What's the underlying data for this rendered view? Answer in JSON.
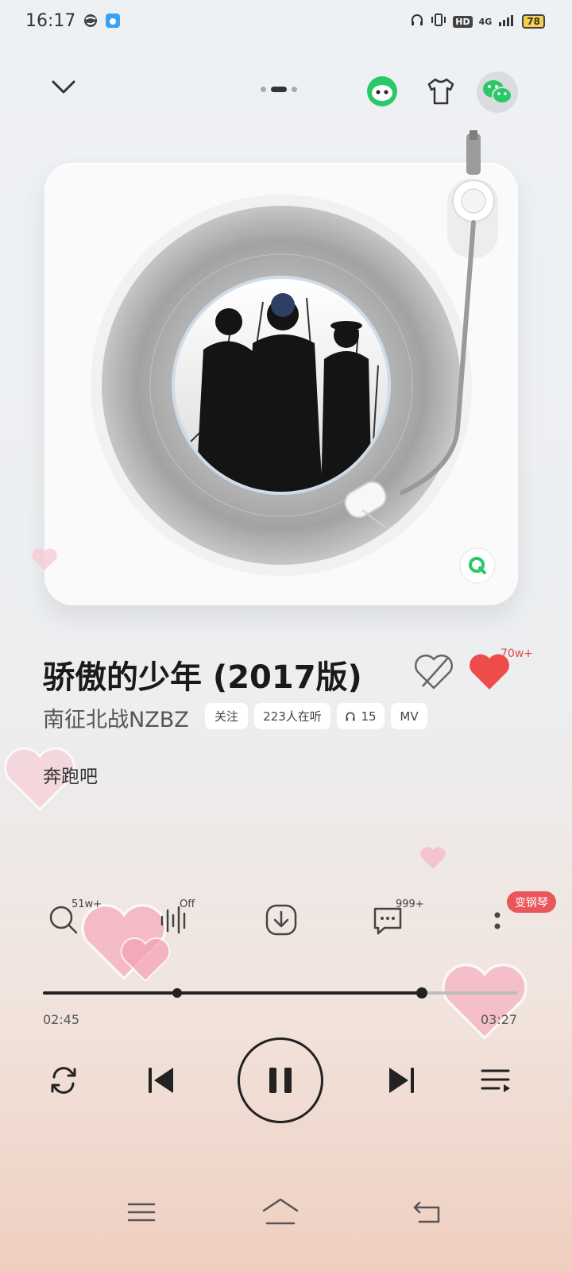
{
  "status_bar": {
    "time": "16:17",
    "network": "4G",
    "hd": "HD",
    "battery": "78"
  },
  "header": {
    "pages": 3,
    "active_page": 2
  },
  "song": {
    "title": "骄傲的少年 (2017版)",
    "artist": "南征北战NZBZ",
    "follow_label": "关注",
    "listeners": "223人在听",
    "headphones_count": "15",
    "mv_label": "MV",
    "lyric": "奔跑吧",
    "like_count": "70w+"
  },
  "actions": {
    "search_count": "51w+",
    "effect_state": "Off",
    "comment_count": "999+",
    "piano_label": "变钢琴"
  },
  "progress": {
    "current": "02:45",
    "total": "03:27",
    "played_fraction": 0.797,
    "marker_fraction": 0.282
  },
  "colors": {
    "accent_red": "#e9575a",
    "wechat_green": "#2bc86a"
  }
}
